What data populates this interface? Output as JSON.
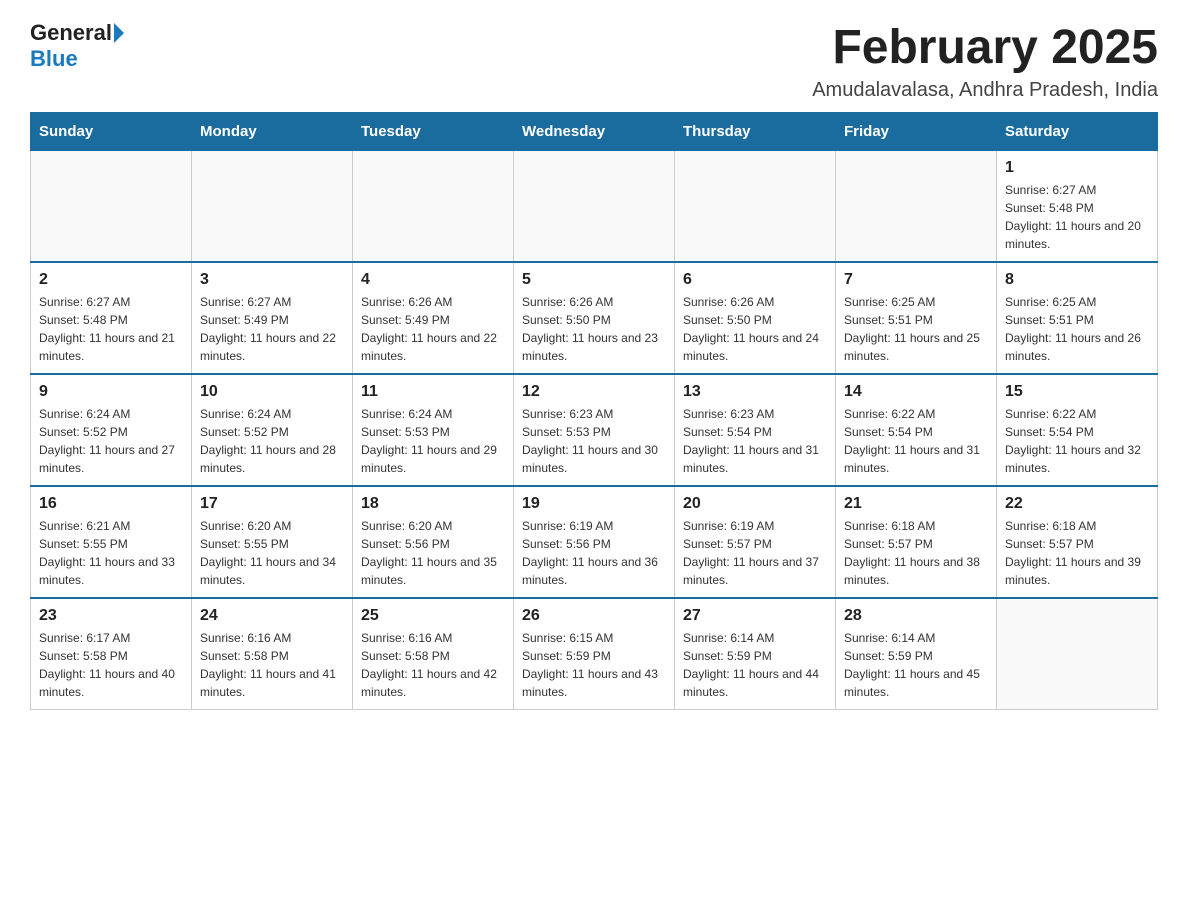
{
  "logo": {
    "general": "General",
    "blue": "Blue"
  },
  "title": "February 2025",
  "subtitle": "Amudalavalasa, Andhra Pradesh, India",
  "weekdays": [
    "Sunday",
    "Monday",
    "Tuesday",
    "Wednesday",
    "Thursday",
    "Friday",
    "Saturday"
  ],
  "weeks": [
    [
      {
        "day": "",
        "info": ""
      },
      {
        "day": "",
        "info": ""
      },
      {
        "day": "",
        "info": ""
      },
      {
        "day": "",
        "info": ""
      },
      {
        "day": "",
        "info": ""
      },
      {
        "day": "",
        "info": ""
      },
      {
        "day": "1",
        "info": "Sunrise: 6:27 AM\nSunset: 5:48 PM\nDaylight: 11 hours and 20 minutes."
      }
    ],
    [
      {
        "day": "2",
        "info": "Sunrise: 6:27 AM\nSunset: 5:48 PM\nDaylight: 11 hours and 21 minutes."
      },
      {
        "day": "3",
        "info": "Sunrise: 6:27 AM\nSunset: 5:49 PM\nDaylight: 11 hours and 22 minutes."
      },
      {
        "day": "4",
        "info": "Sunrise: 6:26 AM\nSunset: 5:49 PM\nDaylight: 11 hours and 22 minutes."
      },
      {
        "day": "5",
        "info": "Sunrise: 6:26 AM\nSunset: 5:50 PM\nDaylight: 11 hours and 23 minutes."
      },
      {
        "day": "6",
        "info": "Sunrise: 6:26 AM\nSunset: 5:50 PM\nDaylight: 11 hours and 24 minutes."
      },
      {
        "day": "7",
        "info": "Sunrise: 6:25 AM\nSunset: 5:51 PM\nDaylight: 11 hours and 25 minutes."
      },
      {
        "day": "8",
        "info": "Sunrise: 6:25 AM\nSunset: 5:51 PM\nDaylight: 11 hours and 26 minutes."
      }
    ],
    [
      {
        "day": "9",
        "info": "Sunrise: 6:24 AM\nSunset: 5:52 PM\nDaylight: 11 hours and 27 minutes."
      },
      {
        "day": "10",
        "info": "Sunrise: 6:24 AM\nSunset: 5:52 PM\nDaylight: 11 hours and 28 minutes."
      },
      {
        "day": "11",
        "info": "Sunrise: 6:24 AM\nSunset: 5:53 PM\nDaylight: 11 hours and 29 minutes."
      },
      {
        "day": "12",
        "info": "Sunrise: 6:23 AM\nSunset: 5:53 PM\nDaylight: 11 hours and 30 minutes."
      },
      {
        "day": "13",
        "info": "Sunrise: 6:23 AM\nSunset: 5:54 PM\nDaylight: 11 hours and 31 minutes."
      },
      {
        "day": "14",
        "info": "Sunrise: 6:22 AM\nSunset: 5:54 PM\nDaylight: 11 hours and 31 minutes."
      },
      {
        "day": "15",
        "info": "Sunrise: 6:22 AM\nSunset: 5:54 PM\nDaylight: 11 hours and 32 minutes."
      }
    ],
    [
      {
        "day": "16",
        "info": "Sunrise: 6:21 AM\nSunset: 5:55 PM\nDaylight: 11 hours and 33 minutes."
      },
      {
        "day": "17",
        "info": "Sunrise: 6:20 AM\nSunset: 5:55 PM\nDaylight: 11 hours and 34 minutes."
      },
      {
        "day": "18",
        "info": "Sunrise: 6:20 AM\nSunset: 5:56 PM\nDaylight: 11 hours and 35 minutes."
      },
      {
        "day": "19",
        "info": "Sunrise: 6:19 AM\nSunset: 5:56 PM\nDaylight: 11 hours and 36 minutes."
      },
      {
        "day": "20",
        "info": "Sunrise: 6:19 AM\nSunset: 5:57 PM\nDaylight: 11 hours and 37 minutes."
      },
      {
        "day": "21",
        "info": "Sunrise: 6:18 AM\nSunset: 5:57 PM\nDaylight: 11 hours and 38 minutes."
      },
      {
        "day": "22",
        "info": "Sunrise: 6:18 AM\nSunset: 5:57 PM\nDaylight: 11 hours and 39 minutes."
      }
    ],
    [
      {
        "day": "23",
        "info": "Sunrise: 6:17 AM\nSunset: 5:58 PM\nDaylight: 11 hours and 40 minutes."
      },
      {
        "day": "24",
        "info": "Sunrise: 6:16 AM\nSunset: 5:58 PM\nDaylight: 11 hours and 41 minutes."
      },
      {
        "day": "25",
        "info": "Sunrise: 6:16 AM\nSunset: 5:58 PM\nDaylight: 11 hours and 42 minutes."
      },
      {
        "day": "26",
        "info": "Sunrise: 6:15 AM\nSunset: 5:59 PM\nDaylight: 11 hours and 43 minutes."
      },
      {
        "day": "27",
        "info": "Sunrise: 6:14 AM\nSunset: 5:59 PM\nDaylight: 11 hours and 44 minutes."
      },
      {
        "day": "28",
        "info": "Sunrise: 6:14 AM\nSunset: 5:59 PM\nDaylight: 11 hours and 45 minutes."
      },
      {
        "day": "",
        "info": ""
      }
    ]
  ]
}
